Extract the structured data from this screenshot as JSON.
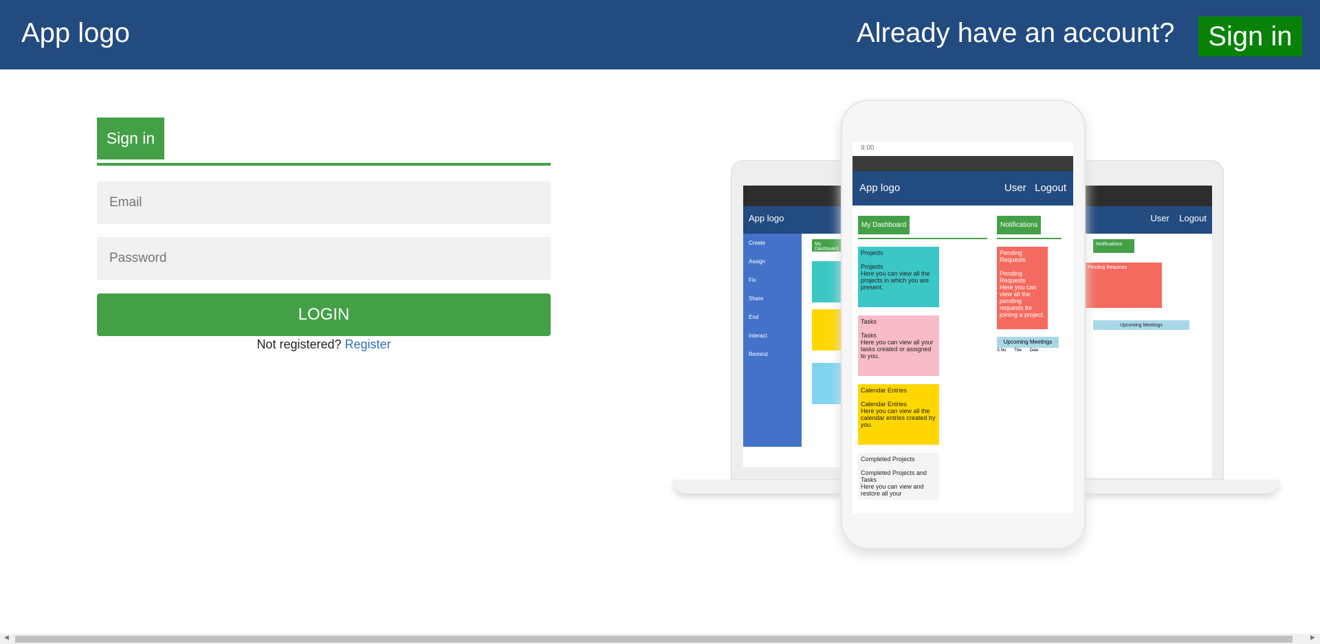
{
  "header": {
    "logo": "App logo",
    "prompt": "Already have an account?",
    "signin_button": "Sign in"
  },
  "form": {
    "tab_label": "Sign in",
    "email_placeholder": "Email",
    "password_placeholder": "Password",
    "login_button": "LOGIN",
    "not_registered": "Not registered?",
    "register_link": "Register"
  },
  "mockup": {
    "laptop": {
      "logo": "App logo",
      "menu": [
        "Create",
        "Assign",
        "Fix",
        "Share",
        "End",
        "Interact",
        "Remind"
      ],
      "dashboard": "My Dashboard",
      "user": "User",
      "logout": "Logout",
      "notifications": "Notifications",
      "pending": "Pending Requests",
      "meetings": "Upcoming Meetings"
    },
    "phone": {
      "time": "9:00",
      "logo": "App logo",
      "user": "User",
      "logout": "Logout",
      "dashboard": "My Dashboard",
      "notifications": "Notifications",
      "projects_header": "Projects",
      "projects_title": "Projects",
      "projects_text": "Here you can view all the projects in which you are present.",
      "tasks_header": "Tasks",
      "tasks_title": "Tasks",
      "tasks_text": "Here you can view all your tasks created or assigned to you.",
      "calendar_header": "Calendar Entries",
      "calendar_title": "Calendar Entries",
      "calendar_text": "Here you can view all the calendar entries created by you.",
      "completed_header": "Completed Projects",
      "completed_title": "Completed Projects and Tasks",
      "completed_text": "Here you can view and restore all your",
      "pending_header": "Pending Requests",
      "pending_title": "Pending Requests",
      "pending_text": "Here you can view all the pending requests for joining a project.",
      "meetings": "Upcoming Meetings",
      "meeting_cols": [
        "S.No",
        "Title",
        "Date"
      ]
    }
  },
  "colors": {
    "header_bg": "#224b80",
    "green": "#43a047",
    "signin_green": "#078207"
  }
}
